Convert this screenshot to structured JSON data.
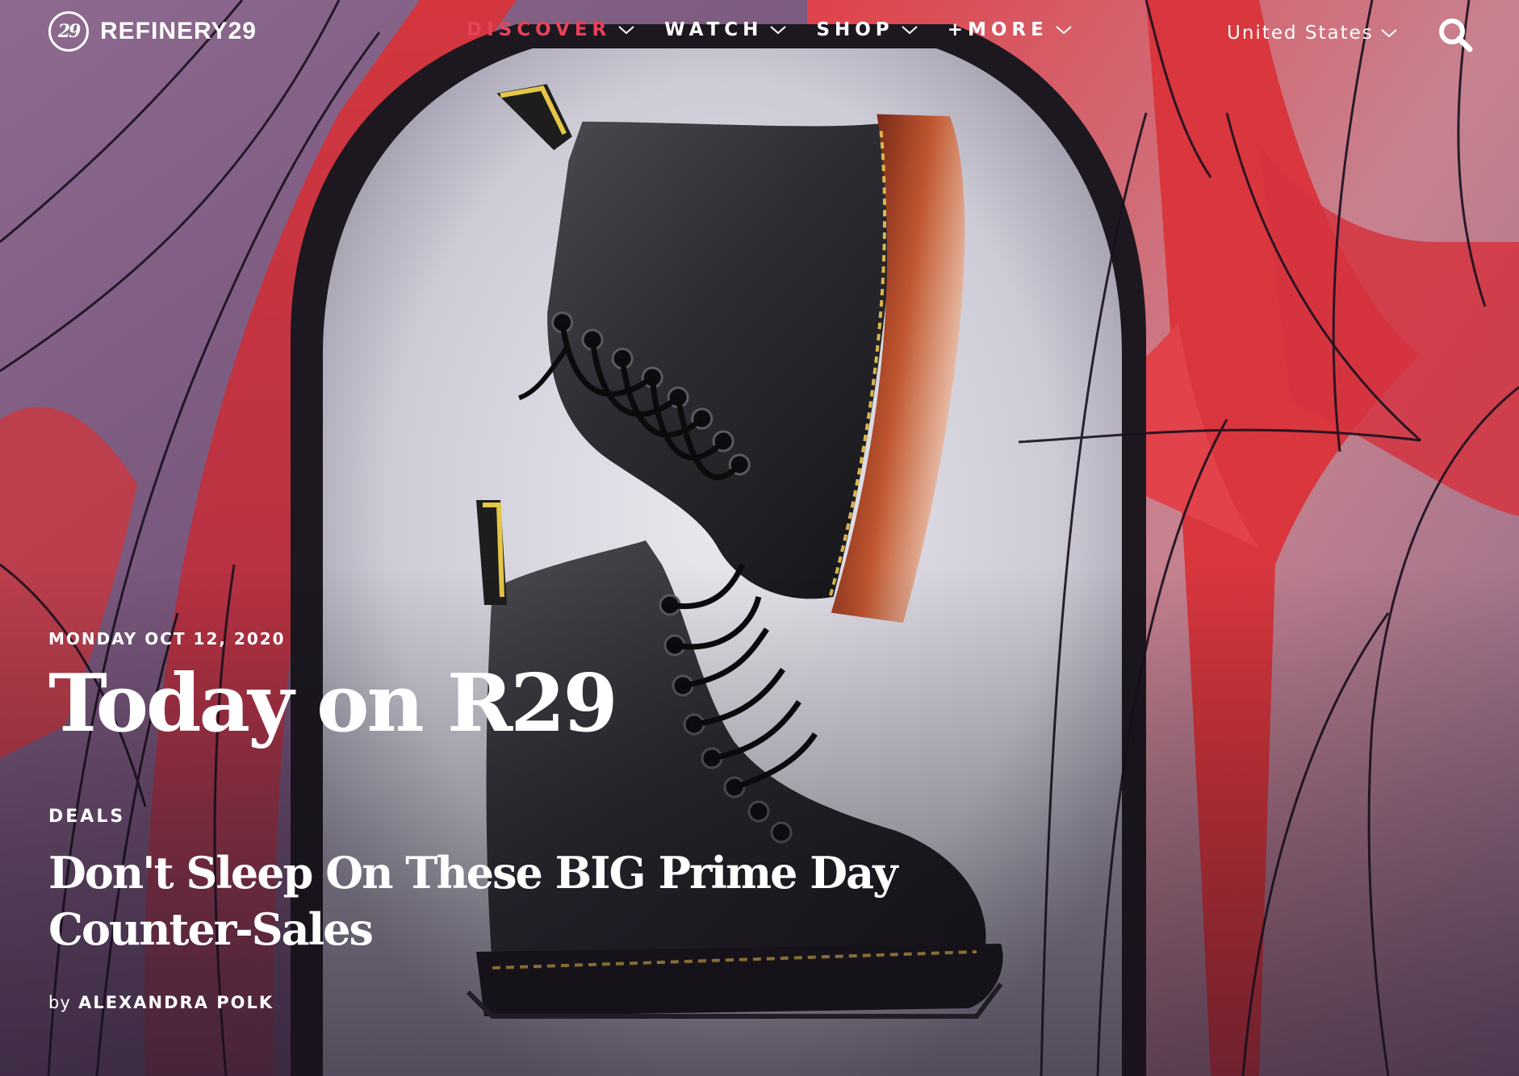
{
  "brand": {
    "logo_mark": "29",
    "name": "REFINERY29"
  },
  "nav": {
    "items": [
      {
        "label": "DISCOVER",
        "active": true
      },
      {
        "label": "WATCH",
        "active": false
      },
      {
        "label": "SHOP",
        "active": false
      },
      {
        "label": "+MORE",
        "active": false
      }
    ],
    "region": "United States",
    "icons": {
      "dropdown": "chevron-down-icon",
      "search": "search-icon"
    }
  },
  "hero": {
    "date": "MONDAY OCT 12, 2020",
    "title": "Today on R29",
    "category": "DEALS",
    "headline": "Don't Sleep On These BIG Prime Day Counter-Sales",
    "byline_prefix": "by",
    "author": "ALEXANDRA POLK"
  },
  "colors": {
    "active_nav": "#e8425a",
    "text": "#ffffff",
    "accent_red": "#d8343a",
    "accent_purple": "#7b5b86"
  }
}
